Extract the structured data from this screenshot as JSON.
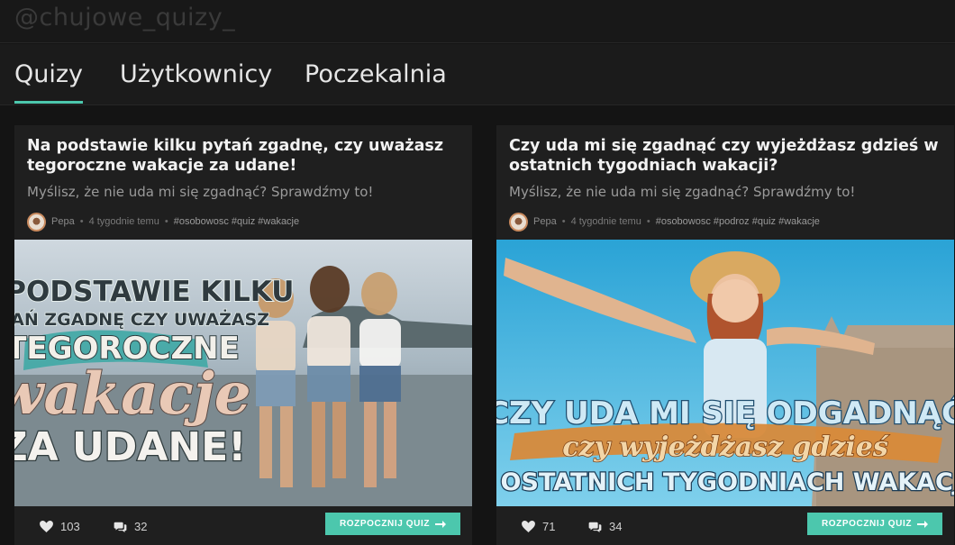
{
  "brand": {
    "handle": "@chujowe_quizy_"
  },
  "nav": {
    "tabs": [
      {
        "label": "Quizy",
        "active": true
      },
      {
        "label": "Użytkownicy",
        "active": false
      },
      {
        "label": "Poczekalnia",
        "active": false
      }
    ]
  },
  "accent_color": "#4cc7ad",
  "quizzes": [
    {
      "title": "Na podstawie kilku pytań zgadnę, czy uważasz tegoroczne wakacje za udane!",
      "description": "Myślisz, że nie uda mi się zgadnąć? Sprawdźmy to!",
      "author": "Pepa",
      "time": "4 tygodnie temu",
      "tags": "#osobowosc #quiz #wakacje",
      "image_text": [
        "NA PODSTAWIE KILKU",
        "PYTAŃ ZGADNĘ CZY UWAŻASZ",
        "TEGOROCZNE",
        "wakacje",
        "ZA UDANE!"
      ],
      "likes": "103",
      "comments": "32",
      "cta": "ROZPOCZNIJ QUIZ"
    },
    {
      "title": "Czy uda mi się zgadnąć czy wyjeżdżasz gdzieś w ostatnich tygodniach wakacji?",
      "description": "Myślisz, że nie uda mi się zgadnąć? Sprawdźmy to!",
      "author": "Pepa",
      "time": "4 tygodnie temu",
      "tags": "#osobowosc #podroz #quiz #wakacje",
      "image_text": [
        "CZY UDA MI SIĘ ODGADNĄĆ",
        "czy wyjeżdżasz gdzieś",
        "W OSTATNICH TYGODNIACH WAKACJI?"
      ],
      "likes": "71",
      "comments": "34",
      "cta": "ROZPOCZNIJ QUIZ"
    }
  ],
  "icons": {
    "like": "heart-icon",
    "comment": "comment-icon",
    "cta_arrow": "arrow-right-icon"
  }
}
